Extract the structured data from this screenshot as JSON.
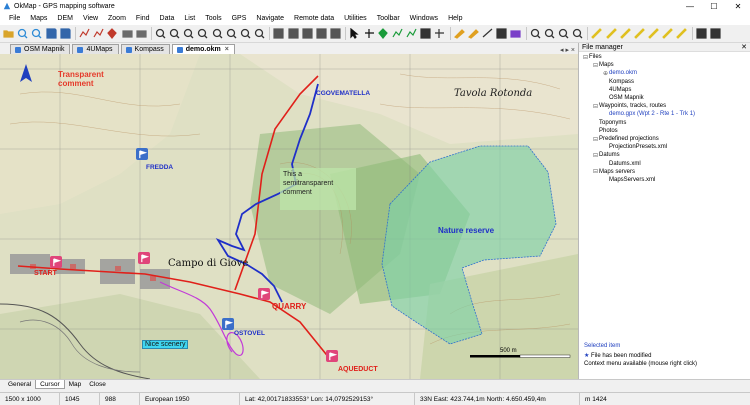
{
  "window": {
    "title": "OkMap - GPS mapping software",
    "minimize": "—",
    "maximize": "☐",
    "close": "✕"
  },
  "menu": [
    "File",
    "Maps",
    "DEM",
    "View",
    "Zoom",
    "Find",
    "Data",
    "List",
    "Tools",
    "GPS",
    "Navigate",
    "Remote data",
    "Utilities",
    "Toolbar",
    "Windows",
    "Help"
  ],
  "tabs": [
    {
      "label": "OSM Mapnik",
      "active": false
    },
    {
      "label": "4UMaps",
      "active": false
    },
    {
      "label": "Kompass",
      "active": false
    },
    {
      "label": "demo.okm",
      "active": true
    }
  ],
  "map": {
    "labels": {
      "transparent_comment": "Transparent\ncomment",
      "cgovematella": "CGOVEMATELLA",
      "tavola_rotonda": "Tavola Rotonda",
      "fredda": "FREDDA",
      "semi_comment": "This a\nsemitransparent\ncomment",
      "nature_reserve": "Nature reserve",
      "campo_di_giove": "Campo di Giove",
      "quarry": "QUARRY",
      "ostovel": "OSTOVEL",
      "nice_scenery": "Nice scenery",
      "aqueduct": "AQUEDUCT",
      "scale": "500 m",
      "start": "START"
    },
    "colors": {
      "track_red": "#e0201a",
      "track_blue": "#1f2fc8",
      "reserve_fill": "#7fd1a8",
      "poi_pink": "#e0457a",
      "poi_blue": "#3b6fc9"
    }
  },
  "panel": {
    "title": "File manager",
    "close": "✕",
    "tree": [
      {
        "label": "Files",
        "toggle": "⊟",
        "color": "black"
      },
      {
        "label": "Maps",
        "toggle": "⊟",
        "color": "black"
      },
      {
        "label": "demo.okm",
        "toggle": "⊕",
        "color": "blue"
      },
      {
        "label": "Kompass",
        "toggle": "",
        "color": "black"
      },
      {
        "label": "4UMaps",
        "toggle": "",
        "color": "black"
      },
      {
        "label": "OSM Mapnik",
        "toggle": "",
        "color": "black"
      },
      {
        "label": "Waypoints, tracks, routes",
        "toggle": "⊟",
        "color": "black"
      },
      {
        "label": "demo.gpx (Wpt 2 - Rte 1 - Trk 1)",
        "toggle": "",
        "color": "blue"
      },
      {
        "label": "Toponyms",
        "toggle": "",
        "color": "black"
      },
      {
        "label": "Photos",
        "toggle": "",
        "color": "black"
      },
      {
        "label": "Predefined projections",
        "toggle": "⊟",
        "color": "black"
      },
      {
        "label": "ProjectionPresets.xml",
        "toggle": "",
        "color": "black"
      },
      {
        "label": "Datums",
        "toggle": "⊟",
        "color": "black"
      },
      {
        "label": "Datums.xml",
        "toggle": "",
        "color": "black"
      },
      {
        "label": "Maps servers",
        "toggle": "⊟",
        "color": "black"
      },
      {
        "label": "MapsServers.xml",
        "toggle": "",
        "color": "black"
      }
    ],
    "info": {
      "selected": "Selected item",
      "modified": "File has been modified",
      "context": "Context menu available (mouse right click)"
    }
  },
  "bottom_tabs": [
    {
      "label": "General",
      "active": false
    },
    {
      "label": "Cursor",
      "active": true
    },
    {
      "label": "Map",
      "active": false
    },
    {
      "label": "Close",
      "active": false
    }
  ],
  "status": {
    "size": "1500 x 1000",
    "x": "1045",
    "y": "988",
    "datum": "European 1950",
    "latlon": "Lat: 42,00171833553°  Lon: 14,0792529153°",
    "utm": "33N  East: 423.744,1m  North: 4.650.459,4m",
    "alt": "m 1424"
  }
}
